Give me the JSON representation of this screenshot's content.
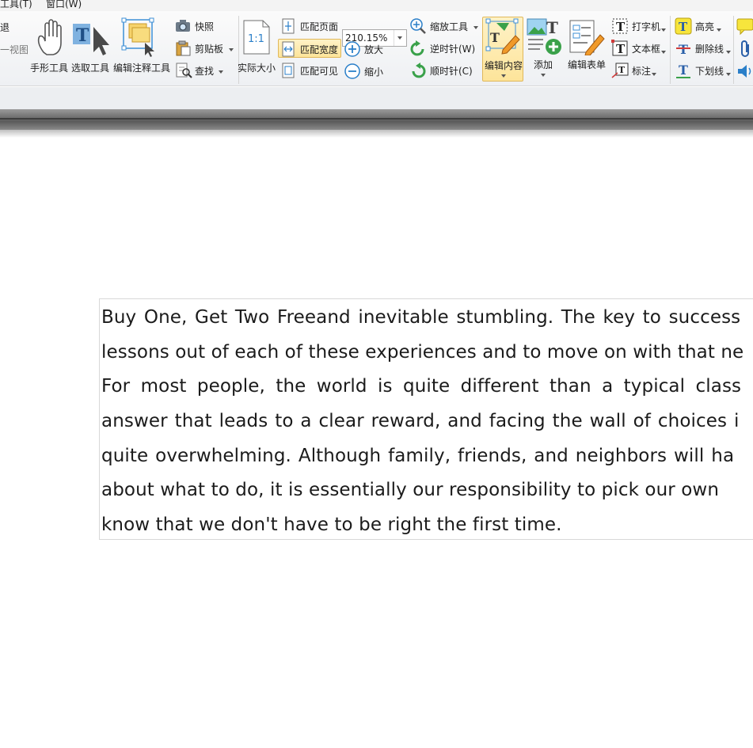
{
  "menubar": {
    "items": [
      "工具(T)",
      "窗口(W)"
    ]
  },
  "ribbon": {
    "left_partial": {
      "top": "退",
      "bottom": "一视图"
    },
    "hand_tool": "手形工具",
    "select_tool": "选取工具",
    "edit_annotation_tool": "编辑注释工具",
    "snapshot": "快照",
    "clipboard": "剪贴板",
    "find": "查找",
    "actual_size": "实际大小",
    "fit_page": "匹配页面",
    "fit_width": "匹配宽度",
    "fit_visible": "匹配可见",
    "zoom_value": "210.15%",
    "zoom_in": "放大",
    "zoom_out": "缩小",
    "zoom_tool": "缩放工具",
    "rotate_ccw": "逆时针(W)",
    "rotate_cw": "顺时针(C)",
    "edit_content": "编辑内容",
    "add": "添加",
    "edit_form": "编辑表单",
    "typewriter": "打字机",
    "textbox": "文本框",
    "callout": "标注",
    "highlight": "高亮",
    "strikeout": "删除线",
    "underline": "下划线"
  },
  "document": {
    "lines": [
      "Buy One, Get Two Freeand inevitable stumbling. The key to success",
      "lessons out of each of these experiences and to move on with that ne",
      "For most people, the world is quite different than a typical class",
      "answer that leads to a clear reward, and facing the wall of choices i",
      "quite overwhelming. Although family, friends, and neighbors will ha",
      "about what to do, it is essentially our responsibility to pick our own",
      "know that we don't have to be right the first time."
    ]
  },
  "colors": {
    "accent_blue": "#2a7fc9",
    "active_bg": "#fde49a",
    "green": "#3aa14a",
    "red": "#d03a3a"
  }
}
